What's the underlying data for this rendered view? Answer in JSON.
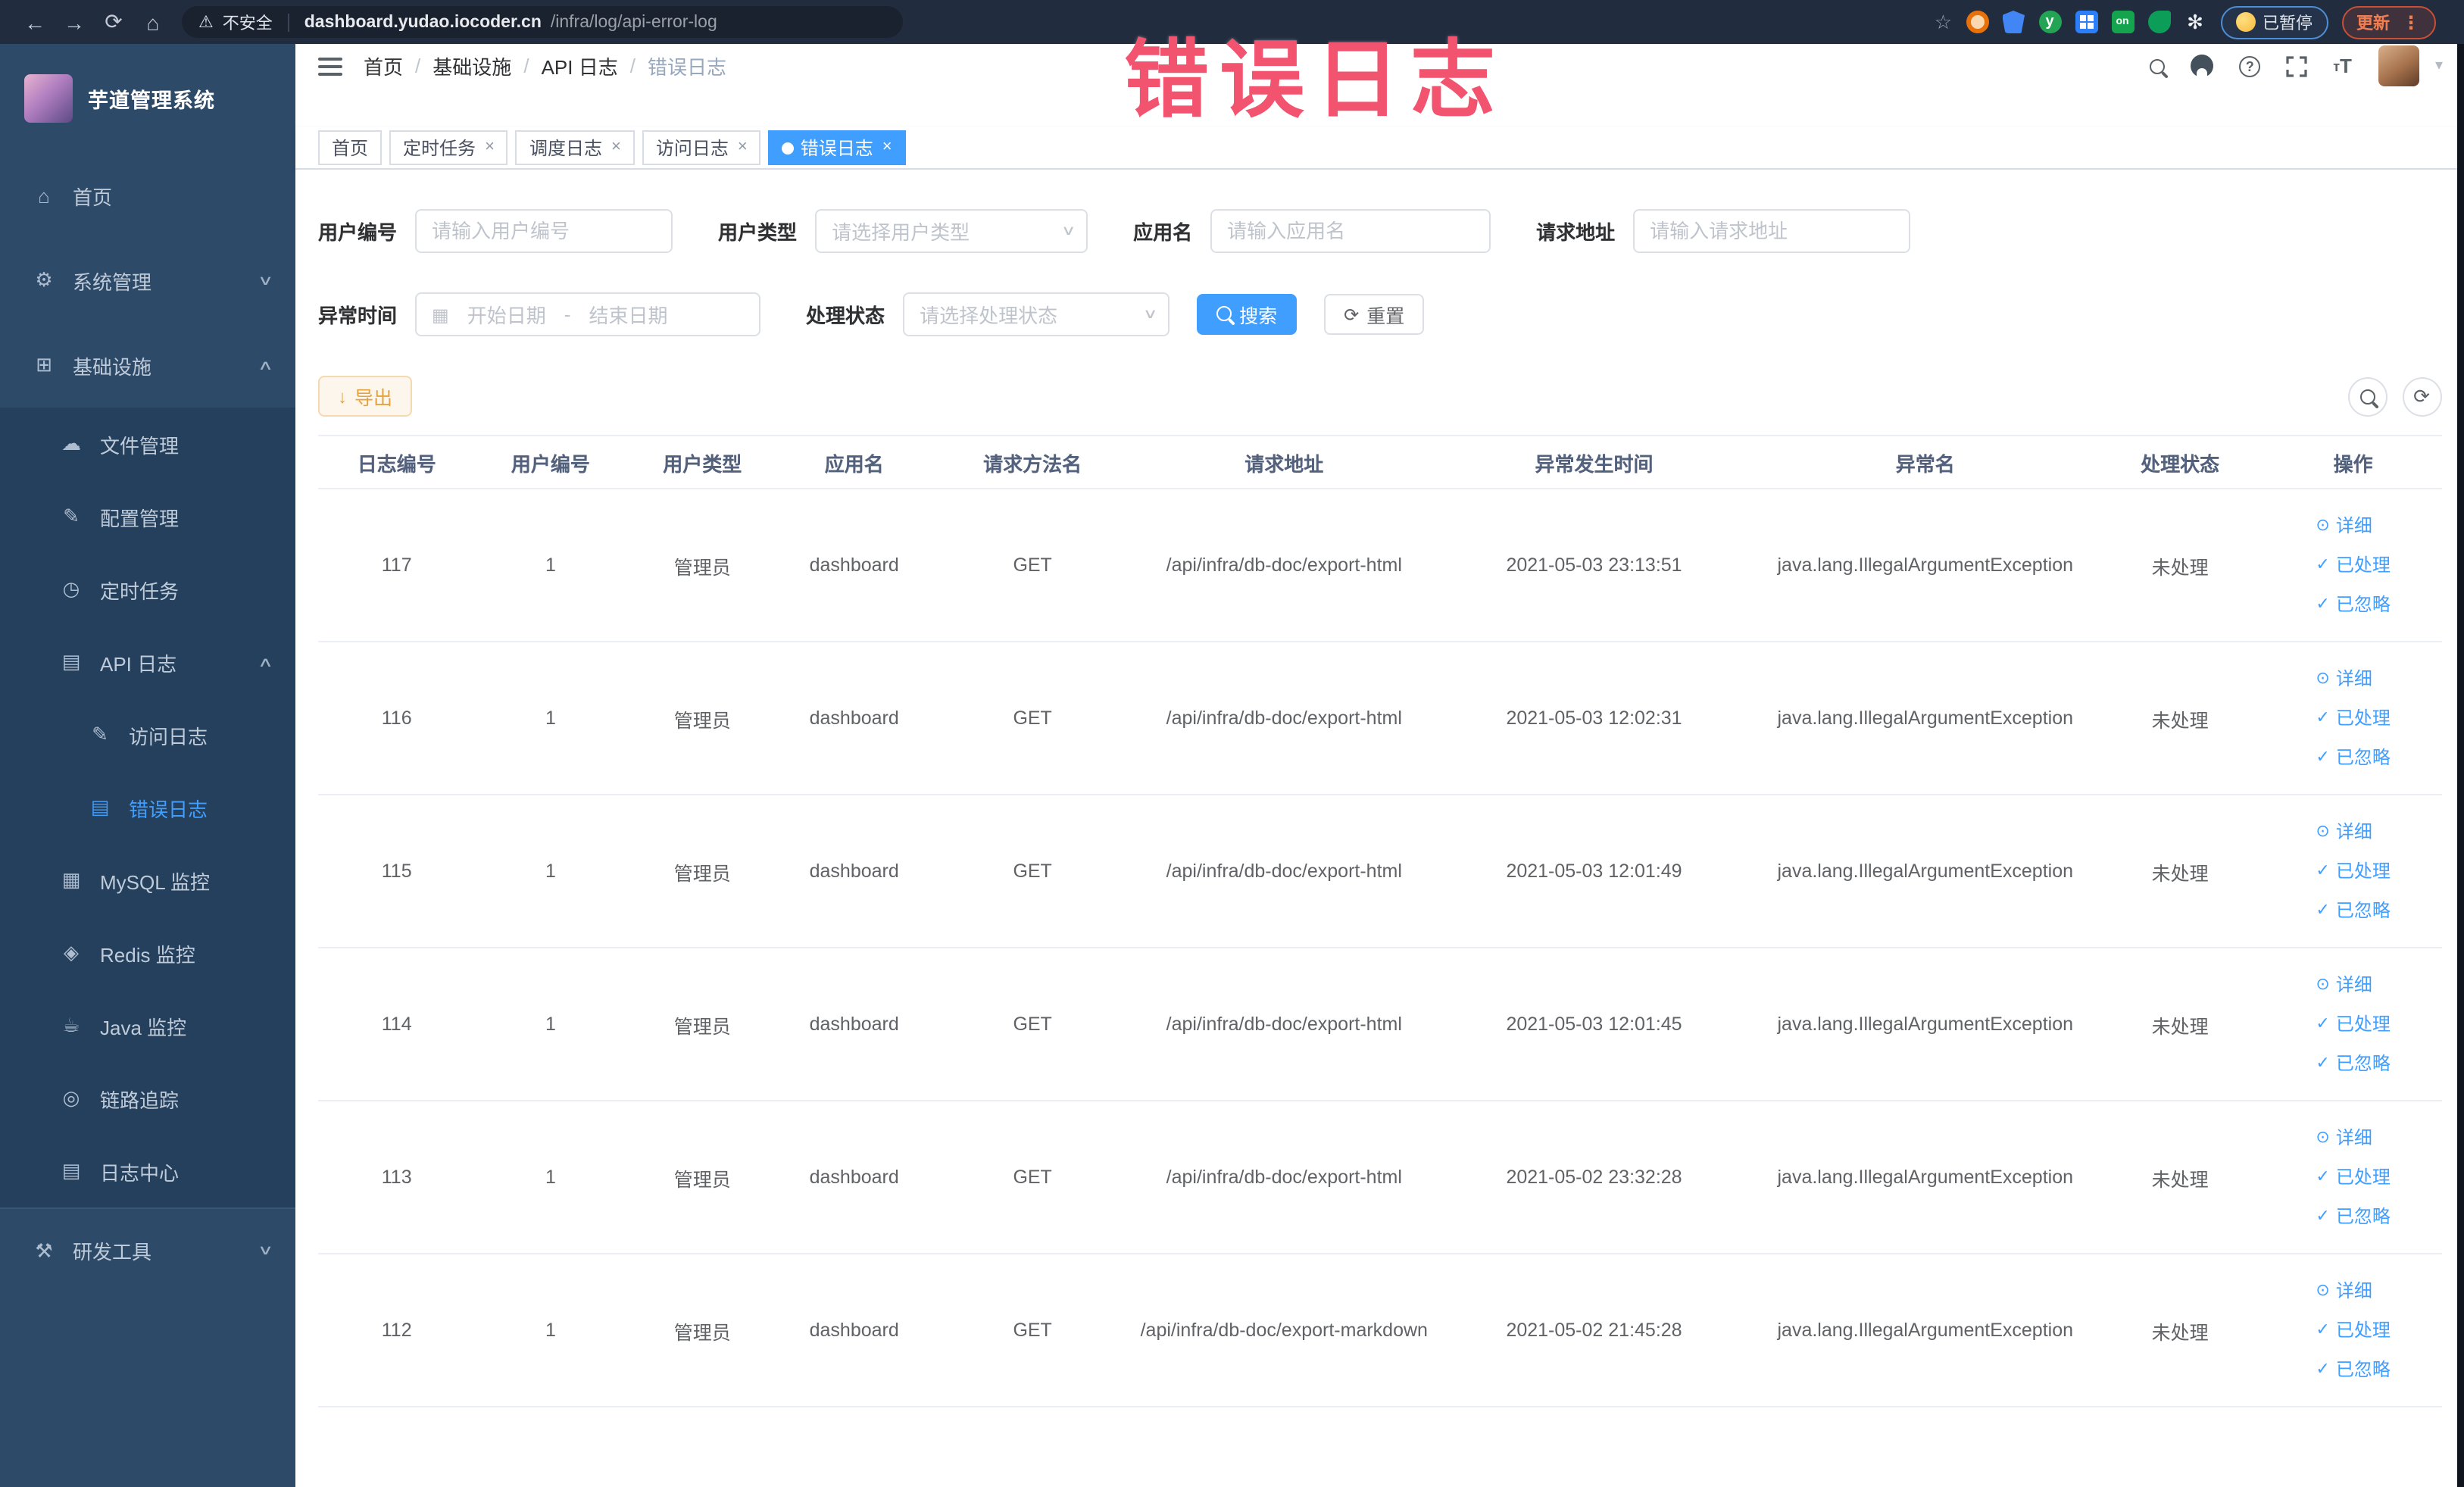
{
  "browser": {
    "security_label": "不安全",
    "url_domain": "dashboard.yudao.iocoder.cn",
    "url_path": "/infra/log/api-error-log",
    "paused_badge": "已暂停",
    "update_badge": "更新"
  },
  "overlay": {
    "text": "错误日志"
  },
  "colors": {
    "accent": "#409eff",
    "warning": "#e6a23c",
    "overlay_text": "#f2536e",
    "sidebar_bg": "#2d4a68",
    "submenu_bg": "#24405d"
  },
  "sidebar": {
    "logo_title": "芋道管理系统",
    "items": [
      {
        "key": "home",
        "label": "首页",
        "icon": "home-icon",
        "level": 0
      },
      {
        "key": "system-manage",
        "label": "系统管理",
        "icon": "gear-icon",
        "level": 0,
        "chevron": "down"
      },
      {
        "key": "infrastructure",
        "label": "基础设施",
        "icon": "infrastructure-icon",
        "level": 0,
        "chevron": "up"
      },
      {
        "key": "file-manage",
        "label": "文件管理",
        "icon": "file-manage-icon",
        "level": 1
      },
      {
        "key": "config-manage",
        "label": "配置管理",
        "icon": "config-manage-icon",
        "level": 1
      },
      {
        "key": "scheduled-task",
        "label": "定时任务",
        "icon": "scheduled-task-icon",
        "level": 1
      },
      {
        "key": "api-log",
        "label": "API 日志",
        "icon": "api-log-icon",
        "level": 1,
        "chevron": "up"
      },
      {
        "key": "access-log",
        "label": "访问日志",
        "icon": "access-log-icon",
        "level": 2
      },
      {
        "key": "error-log",
        "label": "错误日志",
        "icon": "error-log-icon",
        "level": 2,
        "active": true
      },
      {
        "key": "mysql-monitor",
        "label": "MySQL 监控",
        "icon": "mysql-monitor-icon",
        "level": 1
      },
      {
        "key": "redis-monitor",
        "label": "Redis 监控",
        "icon": "redis-monitor-icon",
        "level": 1
      },
      {
        "key": "java-monitor",
        "label": "Java 监控",
        "icon": "java-monitor-icon",
        "level": 1
      },
      {
        "key": "trace",
        "label": "链路追踪",
        "icon": "trace-icon",
        "level": 1
      },
      {
        "key": "log-center",
        "label": "日志中心",
        "icon": "log-center-icon",
        "level": 1
      },
      {
        "key": "dev-tools",
        "label": "研发工具",
        "icon": "dev-tools-icon",
        "level": 0,
        "chevron": "down",
        "top_section": true
      }
    ]
  },
  "breadcrumb": {
    "items": [
      "首页",
      "基础设施",
      "API 日志",
      "错误日志"
    ]
  },
  "tabs": [
    {
      "key": "home",
      "label": "首页",
      "closable": false,
      "active": false
    },
    {
      "key": "scheduled-task",
      "label": "定时任务",
      "closable": true,
      "active": false
    },
    {
      "key": "schedule-log",
      "label": "调度日志",
      "closable": true,
      "active": false
    },
    {
      "key": "access-log",
      "label": "访问日志",
      "closable": true,
      "active": false
    },
    {
      "key": "error-log",
      "label": "错误日志",
      "closable": true,
      "active": true
    }
  ],
  "filters": {
    "user_id": {
      "label": "用户编号",
      "placeholder": "请输入用户编号"
    },
    "user_type": {
      "label": "用户类型",
      "placeholder": "请选择用户类型"
    },
    "app_name": {
      "label": "应用名",
      "placeholder": "请输入应用名"
    },
    "request_url": {
      "label": "请求地址",
      "placeholder": "请输入请求地址"
    },
    "exception_time": {
      "label": "异常时间",
      "start_placeholder": "开始日期",
      "separator": "-",
      "end_placeholder": "结束日期"
    },
    "process_status": {
      "label": "处理状态",
      "placeholder": "请选择处理状态"
    },
    "search_button": "搜索",
    "reset_button": "重置"
  },
  "toolbar": {
    "export_button": "导出"
  },
  "table": {
    "columns": [
      "日志编号",
      "用户编号",
      "用户类型",
      "应用名",
      "请求方法名",
      "请求地址",
      "异常发生时间",
      "异常名",
      "处理状态",
      "操作"
    ],
    "actions": [
      "详细",
      "已处理",
      "已忽略"
    ],
    "rows": [
      {
        "id": "117",
        "user_id": "1",
        "user_type": "管理员",
        "app": "dashboard",
        "method": "GET",
        "url": "/api/infra/db-doc/export-html",
        "time": "2021-05-03 23:13:51",
        "exception": "java.lang.IllegalArgumentException",
        "status": "未处理"
      },
      {
        "id": "116",
        "user_id": "1",
        "user_type": "管理员",
        "app": "dashboard",
        "method": "GET",
        "url": "/api/infra/db-doc/export-html",
        "time": "2021-05-03 12:02:31",
        "exception": "java.lang.IllegalArgumentException",
        "status": "未处理"
      },
      {
        "id": "115",
        "user_id": "1",
        "user_type": "管理员",
        "app": "dashboard",
        "method": "GET",
        "url": "/api/infra/db-doc/export-html",
        "time": "2021-05-03 12:01:49",
        "exception": "java.lang.IllegalArgumentException",
        "status": "未处理"
      },
      {
        "id": "114",
        "user_id": "1",
        "user_type": "管理员",
        "app": "dashboard",
        "method": "GET",
        "url": "/api/infra/db-doc/export-html",
        "time": "2021-05-03 12:01:45",
        "exception": "java.lang.IllegalArgumentException",
        "status": "未处理"
      },
      {
        "id": "113",
        "user_id": "1",
        "user_type": "管理员",
        "app": "dashboard",
        "method": "GET",
        "url": "/api/infra/db-doc/export-html",
        "time": "2021-05-02 23:32:28",
        "exception": "java.lang.IllegalArgumentException",
        "status": "未处理"
      },
      {
        "id": "112",
        "user_id": "1",
        "user_type": "管理员",
        "app": "dashboard",
        "method": "GET",
        "url": "/api/infra/db-doc/export-markdown",
        "time": "2021-05-02 21:45:28",
        "exception": "java.lang.IllegalArgumentException",
        "status": "未处理"
      }
    ]
  }
}
